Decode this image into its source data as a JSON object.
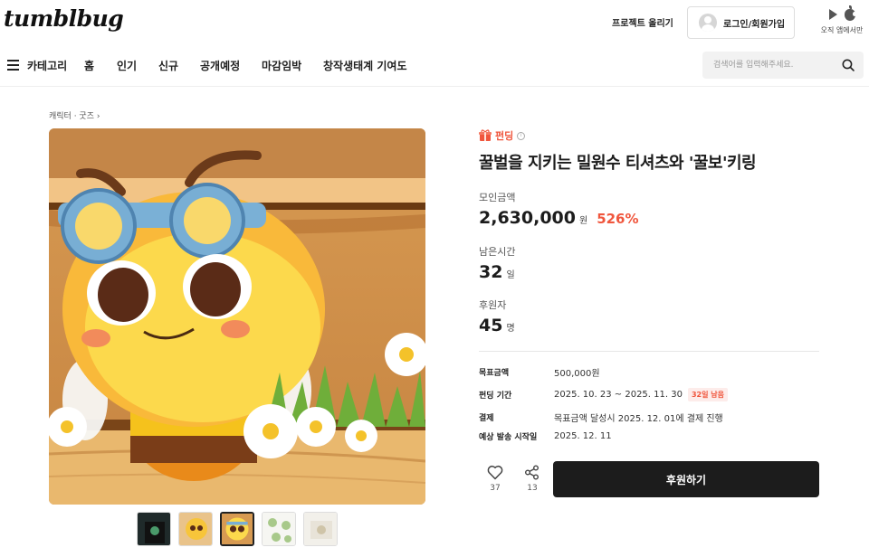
{
  "header": {
    "logo": "tumblbug",
    "project_link": "프로젝트 올리기",
    "login_label": "로그인/회원가입",
    "app_label": "오직 앱에서만"
  },
  "nav": {
    "items": [
      "카테고리",
      "홈",
      "인기",
      "신규",
      "공개예정",
      "마감임박",
      "창작생태계 기여도"
    ],
    "search_placeholder": "검색어를 입력해주세요."
  },
  "breadcrumb": "캐릭터 · 굿즈 ›",
  "project": {
    "badge": "펀딩",
    "info_glyph": "i",
    "title": "꿀벌을 지키는 밀원수 티셔츠와 '꿀보'키링",
    "stats": {
      "amount_label": "모인금액",
      "amount_value": "2,630,000",
      "amount_unit": "원",
      "percent": "526%",
      "time_label": "남은시간",
      "time_value": "32",
      "time_unit": "일",
      "backers_label": "후원자",
      "backers_value": "45",
      "backers_unit": "명"
    },
    "details": [
      {
        "key": "목표금액",
        "value": "500,000원"
      },
      {
        "key": "펀딩 기간",
        "value": "2025. 10. 23 ~ 2025. 11. 30",
        "badge": "32일 남음"
      },
      {
        "key": "결제",
        "value": "목표금액 달성시 2025. 12. 01에 결제 진행"
      },
      {
        "key": "예상 발송 시작일",
        "value": "2025. 12. 11"
      }
    ],
    "like_count": "37",
    "share_count": "13",
    "back_button": "후원하기"
  },
  "colors": {
    "accent": "#f0563d",
    "button_dark": "#1c1c1c"
  },
  "icons": [
    "hamburger-icon",
    "search-icon",
    "play-store-icon",
    "apple-icon",
    "gift-icon",
    "info-icon",
    "heart-icon",
    "share-icon"
  ]
}
